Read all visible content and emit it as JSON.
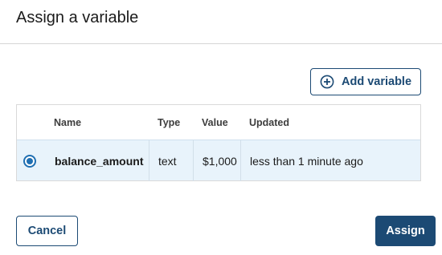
{
  "dialog": {
    "title": "Assign a variable"
  },
  "toolbar": {
    "add_variable_label": "Add variable",
    "add_icon": "plus-circle-icon"
  },
  "table": {
    "columns": {
      "name": "Name",
      "type": "Type",
      "value": "Value",
      "updated": "Updated"
    },
    "rows": [
      {
        "selected": true,
        "name": "balance_amount",
        "type": "text",
        "value": "$1,000",
        "updated": "less than 1 minute ago"
      }
    ]
  },
  "footer": {
    "cancel_label": "Cancel",
    "assign_label": "Assign"
  },
  "colors": {
    "primary": "#1c4a74",
    "selected_row_bg": "#e8f3fb",
    "radio": "#1f6fb2"
  }
}
